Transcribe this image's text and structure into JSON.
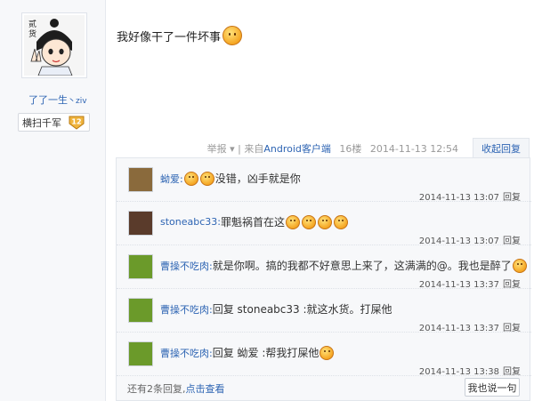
{
  "author": {
    "name": "了了一生",
    "name_suffix": "丶ziv",
    "badge_label": "横扫千军",
    "badge_level": "12"
  },
  "post": {
    "text": "我好像干了一件坏事",
    "actions": {
      "report": "举报",
      "source": "| 来自",
      "client": "Android客户端",
      "floor": "16楼",
      "time": "2014-11-13 12:54",
      "collapse": "收起回复"
    }
  },
  "replies": [
    {
      "name": "蚴爱:",
      "text": "没错，凶手就是你",
      "time": "2014-11-13 13:07",
      "reply": "回复",
      "avatar_color": "#8a6a3c",
      "emojis": 2,
      "emoji_pos": "before"
    },
    {
      "name": "stoneabc33:",
      "text": "罪魁祸首在这",
      "time": "2014-11-13 13:07",
      "reply": "回复",
      "avatar_color": "#5a3b2b",
      "emojis": 4,
      "emoji_pos": "after"
    },
    {
      "name": "曹操不吃肉:",
      "text": "就是你啊。搞的我都不好意思上来了，这满满的@。我也是醉了",
      "time": "2014-11-13 13:37",
      "reply": "回复",
      "avatar_color": "#6b9a2a",
      "emojis": 1,
      "emoji_pos": "after"
    },
    {
      "name": "曹操不吃肉:",
      "text": "回复 stoneabc33 :就这水货。打屎他",
      "time": "2014-11-13 13:37",
      "reply": "回复",
      "avatar_color": "#6b9a2a",
      "emojis": 0,
      "emoji_pos": "after"
    },
    {
      "name": "曹操不吃肉:",
      "text": "回复 蚴爱 :帮我打屎他",
      "time": "2014-11-13 13:38",
      "reply": "回复",
      "avatar_color": "#6b9a2a",
      "emojis": 1,
      "emoji_pos": "after"
    }
  ],
  "footer": {
    "more_text": "还有2条回复,",
    "more_link": "点击查看",
    "say_button": "我也说一句"
  }
}
